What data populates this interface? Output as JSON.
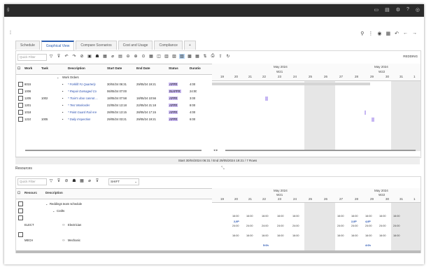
{
  "header": {
    "brand": "ġ",
    "icons": [
      "chat-icon",
      "document-icon",
      "settings-icon",
      "help-icon",
      "user-icon"
    ]
  },
  "subheader": {
    "menu_icon": "⁞",
    "right_icons": [
      "search-icon",
      "more-icon",
      "target-icon",
      "grid-icon",
      "undo-icon",
      "back-icon",
      "forward-icon"
    ]
  },
  "tabs": [
    {
      "label": "Schedule",
      "active": false
    },
    {
      "label": "Graphical View",
      "active": true
    },
    {
      "label": "Compare Scenarios",
      "active": false
    },
    {
      "label": "Cost and Usage",
      "active": false
    },
    {
      "label": "Compliance",
      "active": false
    },
    {
      "label": "+",
      "active": false
    }
  ],
  "top_toolbar": {
    "quick_filter_placeholder": "Quick Filter",
    "right_label": "REDDING"
  },
  "work_grid": {
    "columns": [
      "Work",
      "Task",
      "Description",
      "Start Date",
      "End Date",
      "Status",
      "Duratio"
    ],
    "group_label": "Work Orders",
    "rows": [
      {
        "work": "6015",
        "task": "",
        "desc": "* Forklift #1 Quarterly",
        "start": "30/04/24 06:31",
        "end": "29/05/24 19:21",
        "status": "APPR",
        "dur": "4:00"
      },
      {
        "work": "1006",
        "task": "",
        "desc": "* Repair Damaged Co",
        "start": "06/05/24 07:00",
        "end": "",
        "status": "INAPPR",
        "dur": "24:00"
      },
      {
        "work": "1205",
        "task": "1002",
        "desc": "* Train's door cannot ...",
        "start": "18/05/24 07:58",
        "end": "18/05/24 10:56",
        "status": "APPR",
        "dur": "3:00"
      },
      {
        "work": "1201",
        "task": "",
        "desc": "* Test Workorder",
        "start": "22/05/24 13:18",
        "end": "22/05/24 21:18",
        "status": "APPR",
        "dur": "8:00"
      },
      {
        "work": "1018",
        "task": "",
        "desc": "* Paint Guard Rail Are",
        "start": "28/05/24 13:15",
        "end": "28/05/24 17:15",
        "status": "APPR",
        "dur": "4:00"
      },
      {
        "work": "1210",
        "task": "1005",
        "desc": "* Daily Inspection",
        "start": "29/05/24 03:21",
        "end": "29/05/24 19:21",
        "status": "APPR",
        "dur": "6:00"
      }
    ]
  },
  "timeline": {
    "months": [
      "May 2024",
      "May 2024"
    ],
    "weeks": [
      "W21",
      "W22"
    ],
    "days": [
      "19",
      "20",
      "21",
      "22",
      "23",
      "24",
      "25",
      "26",
      "27",
      "28",
      "29",
      "30",
      "31",
      "1"
    ]
  },
  "status_bar": "Start 30/04/2024 06:31 / End 29/05/2024 19:21 / 7 Rows",
  "resources": {
    "title": "Resources",
    "quick_filter_placeholder": "Quick Filter",
    "shift_label": "SHIFT",
    "columns": [
      "Resourc",
      "Description"
    ],
    "group_label": "Reddings team schedule",
    "sub_group": "Crafts",
    "rows": [
      {
        "code": "ELECT",
        "desc": "Electrician",
        "chips": [
          "16:00",
          "16:00",
          "16:00",
          "16:00",
          "16:00",
          "",
          "",
          "16:00",
          "16:00",
          "16:00",
          "16:00",
          "16:00"
        ],
        "sub": [
          "2,0P",
          "",
          "",
          "",
          "",
          "",
          "",
          "2,0P",
          "",
          "4,0P",
          "",
          ""
        ],
        "sub2": [
          "24:00",
          "24:00",
          "24:00",
          "24:00",
          "24:00",
          "",
          "",
          "24:00",
          "24:00",
          "24:00",
          "24:00",
          "24:00"
        ]
      },
      {
        "code": "MECH",
        "desc": "Mechanic",
        "chips": [
          "16:00",
          "16:00",
          "16:00",
          "16:00",
          "16:00",
          "",
          "",
          "16:00",
          "16:00",
          "16:00",
          "16:00",
          "16:00"
        ],
        "sub": [
          "",
          "",
          "",
          "",
          "",
          "",
          "",
          "",
          "",
          "",
          "",
          ""
        ],
        "sub2": [
          "",
          "",
          "5:0h",
          "",
          "",
          "",
          "",
          "",
          "",
          "4:0h",
          "",
          ""
        ]
      }
    ]
  }
}
